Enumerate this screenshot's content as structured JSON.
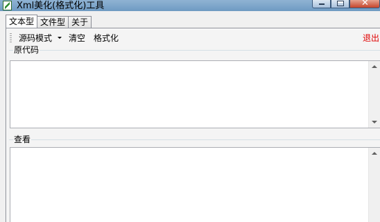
{
  "window": {
    "title": "Xml美化(格式化)工具"
  },
  "tabs": [
    {
      "label": "文本型",
      "active": true
    },
    {
      "label": "文件型",
      "active": false
    },
    {
      "label": "关于",
      "active": false
    }
  ],
  "toolbar": {
    "mode_label": "源码模式",
    "clear_label": "清空",
    "format_label": "格式化",
    "exit_label": "退出"
  },
  "source_group": {
    "label": "原代码",
    "value": ""
  },
  "view_group": {
    "label": "查看",
    "value": ""
  },
  "colors": {
    "exit": "#e00000",
    "titlebar": "#6e9ac2"
  },
  "icons": [
    "xml-app-icon",
    "minimize-icon",
    "maximize-icon",
    "close-icon",
    "dropdown-arrow-icon",
    "scroll-up-icon",
    "scroll-down-icon"
  ]
}
